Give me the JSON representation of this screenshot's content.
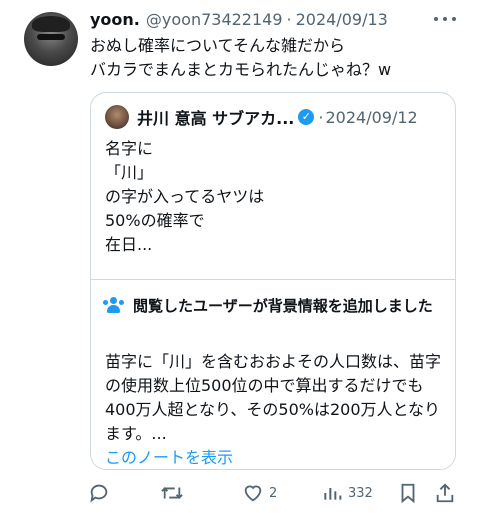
{
  "tweet": {
    "display_name": "yoon.",
    "handle": "@yoon73422149",
    "separator": "·",
    "date": "2024/09/13",
    "text": "おぬし確率についてそんな雑だから\nバカラでまんまとカモられたんじゃね？w"
  },
  "quoted_tweet": {
    "display_name": "井川 意高 サブアカ...",
    "separator": "·",
    "date": "2024/09/12",
    "text": "名字に\n「川」\nの字が入ってるヤツは\n50%の確率で\n在日..."
  },
  "community_note": {
    "heading": "閲覧したユーザーが背景情報を追加しました",
    "body": "苗字に「川」を含むおおよその人口数は、苗字の使用数上位500位の中で算出するだけでも400万人超となり、その50%は200万人となります。...",
    "link": "このノートを表示"
  },
  "actions": {
    "reply_count": "",
    "retweet_count": "",
    "like_count": "2",
    "views_count": "332"
  },
  "icons": [
    "avatar",
    "more-icon",
    "verified-icon",
    "people-icon",
    "reply-icon",
    "retweet-icon",
    "like-icon",
    "views-icon",
    "bookmark-icon",
    "share-icon"
  ],
  "colors": {
    "accent": "#1d9bf0",
    "text": "#0f1419",
    "muted": "#536471",
    "border": "#cfd9de"
  }
}
